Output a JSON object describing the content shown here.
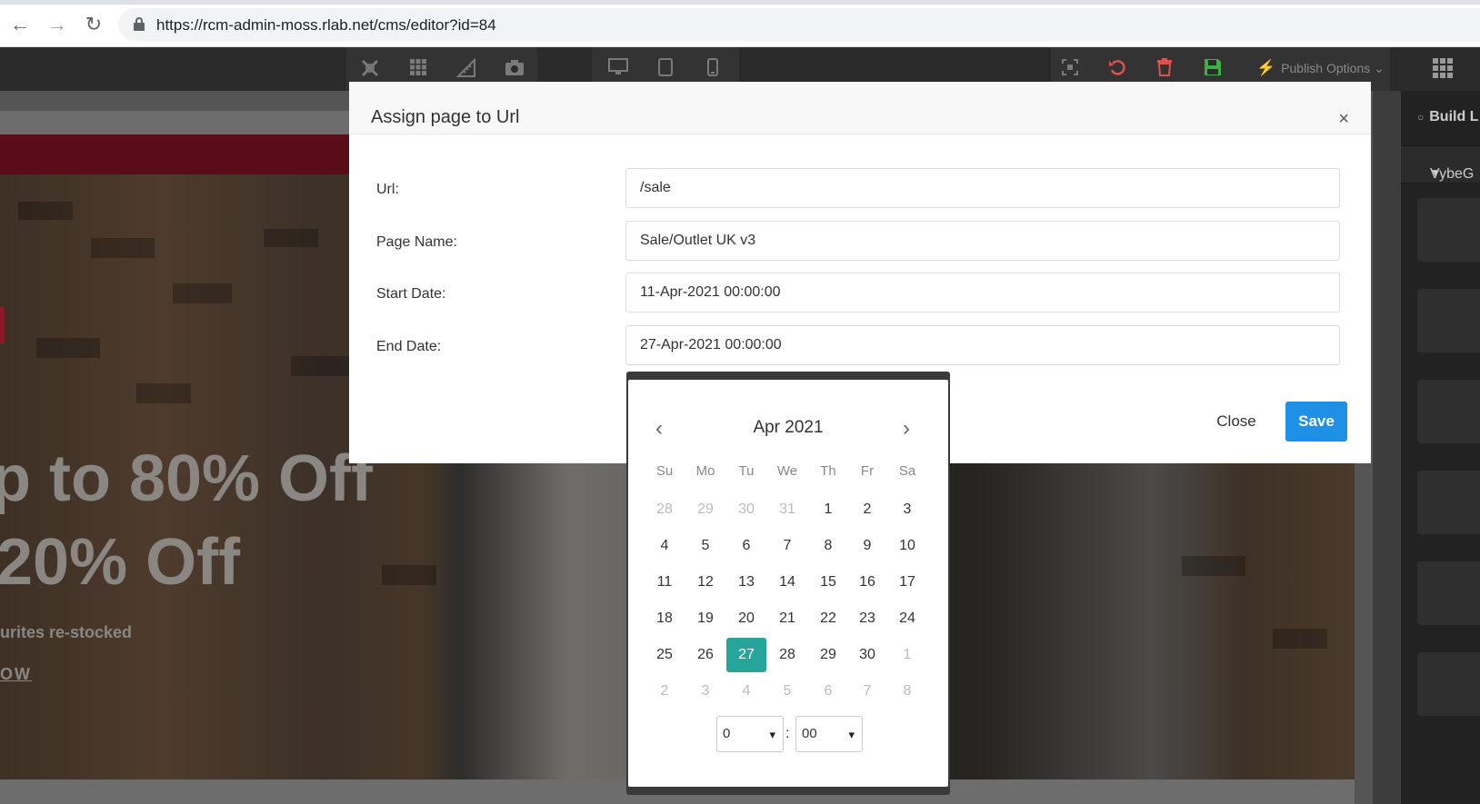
{
  "browser": {
    "url": "https://rcm-admin-moss.rlab.net/cms/editor?id=84"
  },
  "toolbar": {
    "publish_label": "Publish Options",
    "icons": [
      "tools-icon",
      "grid-icon",
      "ruler-icon",
      "camera-icon",
      "desktop-icon",
      "tablet-icon",
      "mobile-icon",
      "fullscreen-icon",
      "undo-icon",
      "delete-icon",
      "save-icon",
      "bolt-icon",
      "apps-icon"
    ],
    "colors": {
      "undo": "#d9534f",
      "delete": "#d9534f",
      "save": "#3fae49",
      "bolt": "#e6a21b"
    }
  },
  "right_panel": {
    "build_label": "Build L",
    "section_label": "VybeG"
  },
  "hero": {
    "line1": "p to 80% Off",
    "line2": "20% Off",
    "line3": "urites re-stocked",
    "line4": "OW"
  },
  "modal": {
    "title": "Assign page to Url",
    "close_icon": "×",
    "fields": [
      {
        "label": "Url:",
        "value": "/sale"
      },
      {
        "label": "Page Name:",
        "value": "Sale/Outlet UK v3"
      },
      {
        "label": "Start Date:",
        "value": "11-Apr-2021 00:00:00"
      },
      {
        "label": "End Date:",
        "value": "27-Apr-2021 00:00:00"
      }
    ],
    "close_label": "Close",
    "save_label": "Save",
    "save_color": "#1e90e6"
  },
  "datepicker": {
    "month_label": "Apr 2021",
    "prev_icon": "‹",
    "next_icon": "›",
    "weekdays": [
      "Su",
      "Mo",
      "Tu",
      "We",
      "Th",
      "Fr",
      "Sa"
    ],
    "weeks": [
      [
        "28",
        "29",
        "30",
        "31",
        "1",
        "2",
        "3"
      ],
      [
        "4",
        "5",
        "6",
        "7",
        "8",
        "9",
        "10"
      ],
      [
        "11",
        "12",
        "13",
        "14",
        "15",
        "16",
        "17"
      ],
      [
        "18",
        "19",
        "20",
        "21",
        "22",
        "23",
        "24"
      ],
      [
        "25",
        "26",
        "27",
        "28",
        "29",
        "30",
        "1"
      ],
      [
        "2",
        "3",
        "4",
        "5",
        "6",
        "7",
        "8"
      ]
    ],
    "muted": [
      [
        0,
        0
      ],
      [
        0,
        1
      ],
      [
        0,
        2
      ],
      [
        0,
        3
      ],
      [
        4,
        6
      ],
      [
        5,
        0
      ],
      [
        5,
        1
      ],
      [
        5,
        2
      ],
      [
        5,
        3
      ],
      [
        5,
        4
      ],
      [
        5,
        5
      ],
      [
        5,
        6
      ]
    ],
    "selected": [
      4,
      2
    ],
    "selected_color": "#26a69a",
    "hour_value": "0",
    "minute_value": "00",
    "time_separator": ":"
  }
}
